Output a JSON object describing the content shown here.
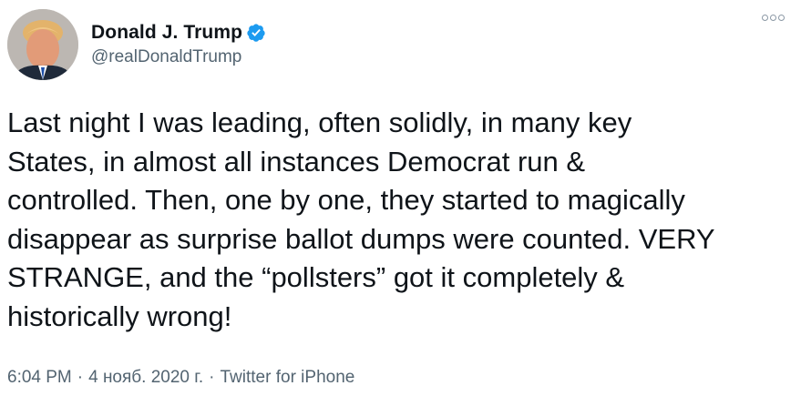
{
  "author": {
    "display_name": "Donald J. Trump",
    "handle": "@realDonaldTrump",
    "verified_icon": "verified-badge-icon",
    "avatar": "profile-photo"
  },
  "menu": {
    "icon": "more-options-icon"
  },
  "tweet": {
    "text": "Last night I was leading, often solidly, in many key\nStates, in almost all instances Democrat run &\ncontrolled. Then, one by one, they started to magically\ndisappear as surprise ballot dumps were counted. VERY\nSTRANGE, and the “pollsters” got it completely &\nhistorically wrong!"
  },
  "meta": {
    "time": "6:04 PM",
    "separator": "·",
    "date": "4 нояб. 2020 г.",
    "source": "Twitter for iPhone"
  },
  "colors": {
    "text": "#0f1419",
    "secondary": "#536471",
    "verified": "#1d9bf0"
  }
}
